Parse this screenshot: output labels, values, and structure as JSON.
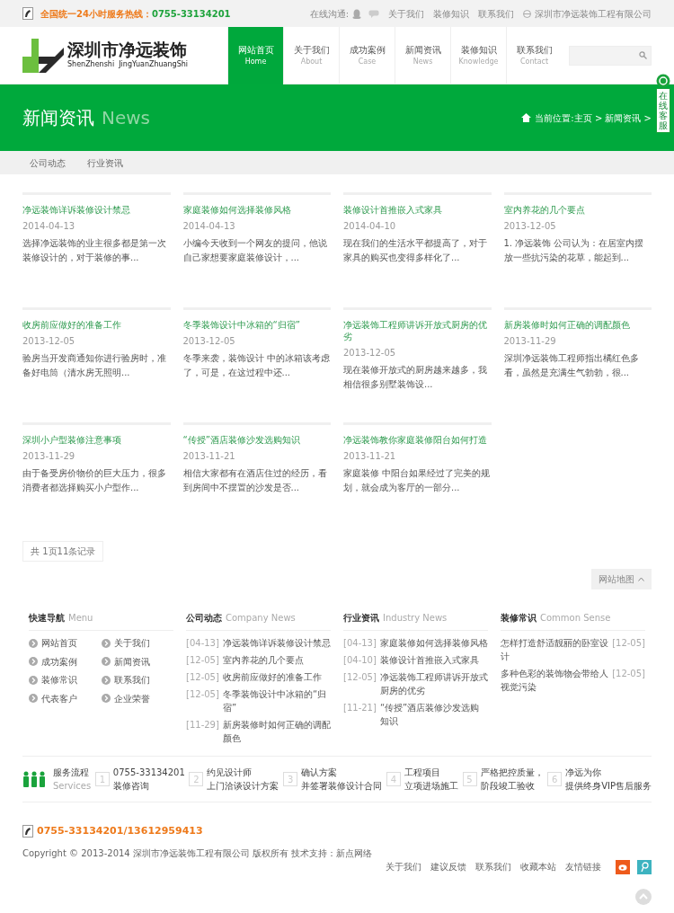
{
  "top_bar": {
    "hotline_label": "全国统一24小时服务热线：",
    "hotline_number": "0755-33134201",
    "online_label": "在线沟通:",
    "links": [
      "关于我们",
      "装修知识",
      "联系我们"
    ],
    "company": "深圳市净远装饰工程有限公司"
  },
  "logo": {
    "name": "深圳市净远装饰",
    "pinyin": "ShenZhenshi  JingYuanZhuangShi"
  },
  "nav": [
    {
      "label": "网站首页",
      "sublabel": "Home",
      "selected": true
    },
    {
      "label": "关于我们",
      "sublabel": "About",
      "selected": false
    },
    {
      "label": "成功案例",
      "sublabel": "Case",
      "selected": false
    },
    {
      "label": "新闻资讯",
      "sublabel": "News",
      "selected": false
    },
    {
      "label": "装修知识",
      "sublabel": "Knowledge",
      "selected": false
    },
    {
      "label": "联系我们",
      "sublabel": "Contact",
      "selected": false
    }
  ],
  "banner": {
    "title": "新闻资讯",
    "subtitle": "News",
    "breadcrumb": "当前位置:主页 > 新闻资讯 >"
  },
  "side_tab": "在线客服",
  "subnav": [
    "公司动态",
    "行业资讯"
  ],
  "news": [
    {
      "title": "净远装饰详诉装修设计禁忌",
      "date": "2014-04-13",
      "summary": "选择净远装饰的业主很多都是第一次装修设计的，对于装修的事..."
    },
    {
      "title": "家庭装修如何选择装修风格",
      "date": "2014-04-13",
      "summary": "小编今天收到一个网友的提问，他说自己家想要家庭装修设计，..."
    },
    {
      "title": "装修设计首推嵌入式家具",
      "date": "2014-04-10",
      "summary": "现在我们的生活水平都提高了，对于家具的购买也变得多样化了..."
    },
    {
      "title": "室内养花的几个要点",
      "date": "2013-12-05",
      "summary": "1. 净远装饰 公司认为：在居室内摆放一些抗污染的花草，能起到..."
    },
    {
      "title": "收房前应做好的准备工作",
      "date": "2013-12-05",
      "summary": "验房当开发商通知你进行验房时，准备好电筒（清水房无照明..."
    },
    {
      "title": "冬季装饰设计中冰箱的“归宿”",
      "date": "2013-12-05",
      "summary": "冬季来袭，装饰设计 中的冰箱该考虑了，可是，在这过程中还..."
    },
    {
      "title": "净远装饰工程师讲诉开放式厨房的优劣",
      "date": "2013-12-05",
      "summary": "现在装修开放式的厨房越来越多，我相信很多别墅装饰设..."
    },
    {
      "title": "新房装修时如何正确的调配颜色",
      "date": "2013-11-29",
      "summary": "深圳净远装饰工程师指出橘红色多看，虽然是充满生气勃勃，很..."
    },
    {
      "title": "深圳小户型装修注意事项",
      "date": "2013-11-29",
      "summary": "由于备受房价物价的巨大压力，很多消费者都选择购买小户型作..."
    },
    {
      "title": "“传授”酒店装修沙发选购知识",
      "date": "2013-11-21",
      "summary": "相信大家都有在酒店住过的经历，看到房间中不摆置的沙发是否..."
    },
    {
      "title": "净远装饰教你家庭装修阳台如何打造",
      "date": "2013-11-21",
      "summary": "家庭装修 中阳台如果经过了完美的规划，就会成为客厅的一部分..."
    }
  ],
  "pagination": "共 1页11条记录",
  "sitemap_button": "网站地图",
  "footer_columns": [
    {
      "title": "快速导航",
      "subtitle": "Menu",
      "kind": "menu",
      "items": [
        {
          "text": "网站首页"
        },
        {
          "text": "关于我们"
        },
        {
          "text": "成功案例"
        },
        {
          "text": "新闻资讯"
        },
        {
          "text": "装修常识"
        },
        {
          "text": "联系我们"
        },
        {
          "text": "代表客户"
        },
        {
          "text": "企业荣誉"
        }
      ]
    },
    {
      "title": "公司动态",
      "subtitle": "Company News",
      "kind": "dated",
      "items": [
        {
          "date": "[04-13]",
          "text": "净远装饰详诉装修设计禁忌"
        },
        {
          "date": "[12-05]",
          "text": "室内养花的几个要点"
        },
        {
          "date": "[12-05]",
          "text": "收房前应做好的准备工作"
        },
        {
          "date": "[12-05]",
          "text": "冬季装饰设计中冰箱的“归宿”"
        },
        {
          "date": "[11-29]",
          "text": "新房装修时如何正确的调配颜色"
        }
      ]
    },
    {
      "title": "行业资讯",
      "subtitle": "Industry News",
      "kind": "dated",
      "items": [
        {
          "date": "[04-13]",
          "text": "家庭装修如何选择装修风格"
        },
        {
          "date": "[04-10]",
          "text": "装修设计首推嵌入式家具"
        },
        {
          "date": "[12-05]",
          "text": "净远装饰工程师讲诉开放式厨房的优劣"
        },
        {
          "date": "[11-21]",
          "text": "“传授”酒店装修沙发选购知识"
        }
      ]
    },
    {
      "title": "装修常识",
      "subtitle": "Common Sense",
      "kind": "date_right",
      "items": [
        {
          "date": "[12-05]",
          "text": "怎样打造舒适靓丽的卧室设计"
        },
        {
          "date": "[12-05]",
          "text": "多种色彩的装饰物会带给人视觉污染"
        }
      ]
    }
  ],
  "services": {
    "title": "服务流程",
    "subtitle": "Services",
    "steps": [
      {
        "number": "1",
        "line1": "0755-33134201",
        "line2": "装修咨询"
      },
      {
        "number": "2",
        "line1": "约见设计师",
        "line2": "上门洽谈设计方案"
      },
      {
        "number": "3",
        "line1": "确认方案",
        "line2": "并签署装修设计合同"
      },
      {
        "number": "4",
        "line1": "工程项目",
        "line2": "立项进场施工"
      },
      {
        "number": "5",
        "line1": "严格把控质量，",
        "line2": "阶段竣工验收"
      },
      {
        "number": "6",
        "line1": "净远为你",
        "line2": "提供终身VIP售后服务"
      }
    ]
  },
  "bottom": {
    "phone": "0755-33134201/13612959413",
    "copyright": "Copyright © 2013-2014 深圳市净远装饰工程有限公司 版权所有 技术支持：新点网络",
    "links": [
      "关于我们",
      "建议反馈",
      "联系我们",
      "收藏本站",
      "友情链接"
    ]
  }
}
